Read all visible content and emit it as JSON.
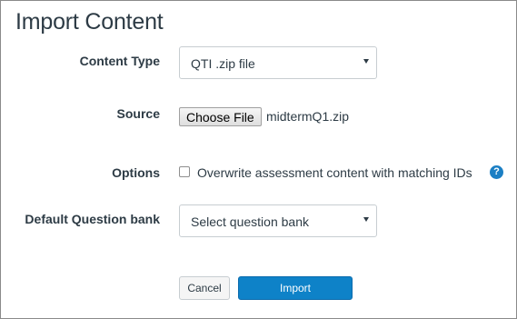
{
  "title": "Import Content",
  "content_type": {
    "label": "Content Type",
    "selected": "QTI .zip file"
  },
  "source": {
    "label": "Source",
    "button_label": "Choose File",
    "file_name": "midtermQ1.zip"
  },
  "options": {
    "label": "Options",
    "overwrite_label": "Overwrite assessment content with matching IDs",
    "overwrite_checked": false,
    "help_glyph": "?",
    "help_icon": "question-circle-icon",
    "help_color": "#1b7fc4"
  },
  "question_bank": {
    "label": "Default Question bank",
    "selected": "Select question bank"
  },
  "actions": {
    "cancel_label": "Cancel",
    "import_label": "Import",
    "import_color": "#0e82c8"
  }
}
